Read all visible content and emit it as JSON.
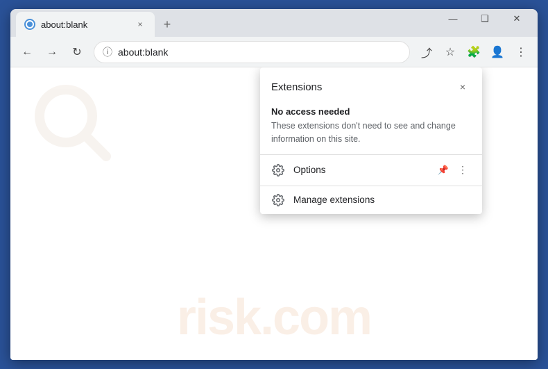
{
  "browser": {
    "tab": {
      "favicon_alt": "page-icon",
      "title": "about:blank",
      "close_label": "×"
    },
    "new_tab_btn": "+",
    "window_controls": {
      "minimize": "—",
      "maximize": "❑",
      "close": "✕"
    },
    "toolbar": {
      "back_btn": "←",
      "forward_btn": "→",
      "reload_btn": "↻",
      "address": "about:blank",
      "share_icon": "⤴",
      "bookmark_icon": "☆",
      "extensions_icon": "🧩",
      "profile_icon": "👤",
      "menu_icon": "⋮"
    }
  },
  "extensions_popup": {
    "title": "Extensions",
    "close_btn": "×",
    "section": {
      "heading": "No access needed",
      "description": "These extensions don't need to see and change information on this site."
    },
    "items": [
      {
        "label": "Options",
        "has_pin": true,
        "has_menu": true
      }
    ],
    "manage_label": "Manage extensions"
  },
  "watermark": {
    "text": "risk.com"
  }
}
